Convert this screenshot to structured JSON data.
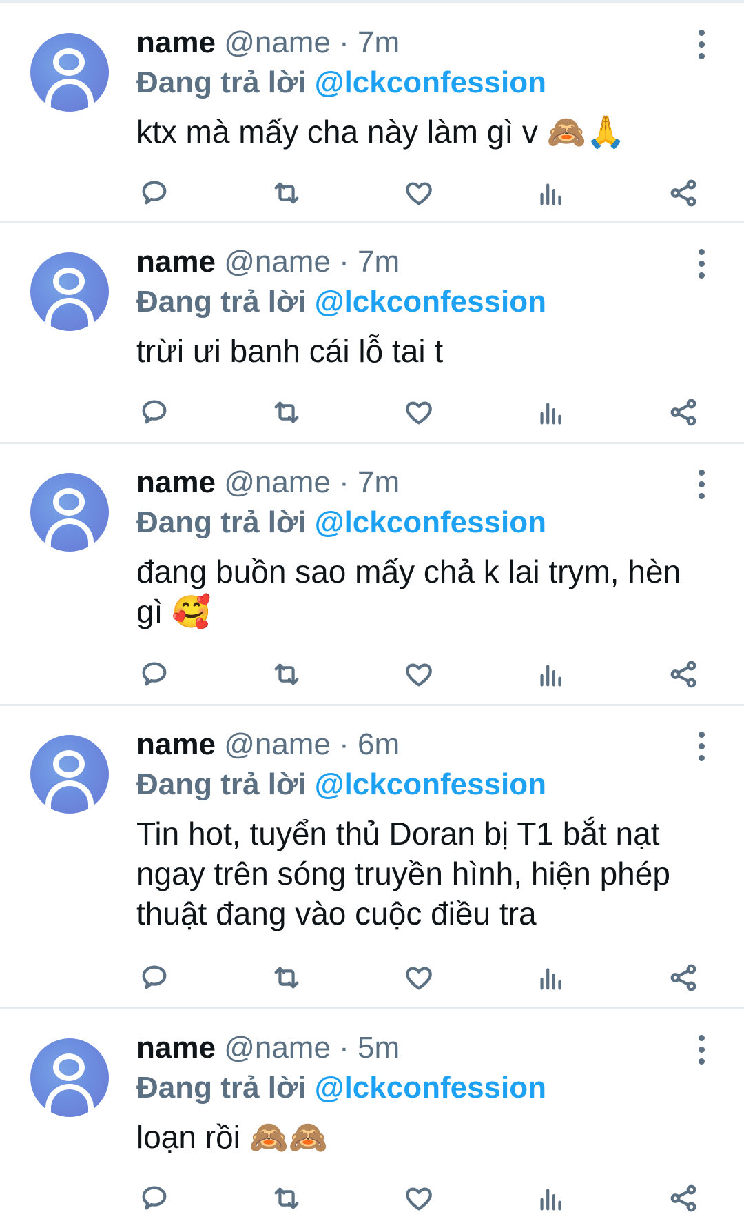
{
  "tweets": [
    {
      "name": "name",
      "handle": "@name",
      "dot": "·",
      "time": "7m",
      "reply_prefix": "Đang trả lời",
      "reply_handle": "@lckconfession",
      "text": "ktx mà mấy cha này làm gì v 🙈🙏"
    },
    {
      "name": "name",
      "handle": "@name",
      "dot": "·",
      "time": "7m",
      "reply_prefix": "Đang trả lời",
      "reply_handle": "@lckconfession",
      "text": "trừi ưi banh cái lỗ tai t"
    },
    {
      "name": "name",
      "handle": "@name",
      "dot": "·",
      "time": "7m",
      "reply_prefix": "Đang trả lời",
      "reply_handle": "@lckconfession",
      "text": "đang buồn sao mấy chả k lai trym, hèn gì 🥰"
    },
    {
      "name": "name",
      "handle": "@name",
      "dot": "·",
      "time": "6m",
      "reply_prefix": "Đang trả lời",
      "reply_handle": "@lckconfession",
      "text": "Tin hot, tuyển thủ Doran bị T1 bắt nạt ngay trên sóng truyền hình, hiện phép thuật đang vào cuộc điều tra"
    },
    {
      "name": "name",
      "handle": "@name",
      "dot": "·",
      "time": "5m",
      "reply_prefix": "Đang trả lời",
      "reply_handle": "@lckconfession",
      "text": "loạn rồi 🙈🙈"
    }
  ],
  "icons": {
    "reply": "reply-icon",
    "retweet": "retweet-icon",
    "like": "heart-icon",
    "analytics": "analytics-icon",
    "share": "share-icon",
    "more": "more-vertical-icon"
  },
  "colors": {
    "link": "#1da1f2",
    "muted": "#5b7083",
    "text": "#0f1419",
    "divider": "#e6ecf0"
  }
}
